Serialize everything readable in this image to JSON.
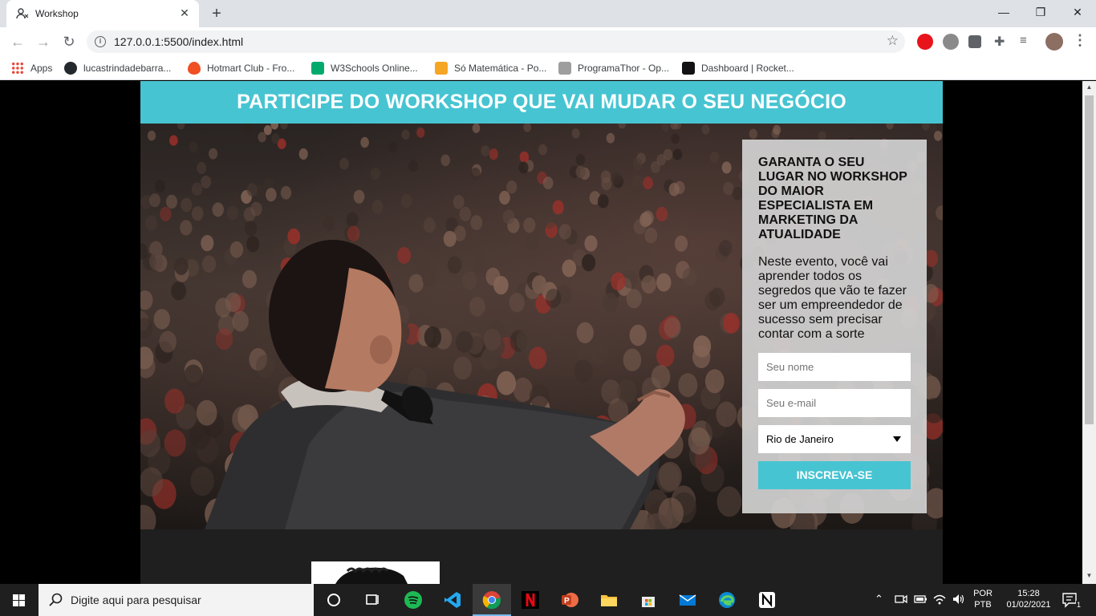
{
  "browser": {
    "tab_title": "Workshop",
    "new_tab": "+",
    "url": "127.0.0.1:5500/index.html",
    "window_controls": {
      "minimize": "—",
      "restore": "❐",
      "close": "✕"
    }
  },
  "bookmarks": [
    {
      "label": "Apps",
      "icon": "apps-grid-icon",
      "color": "#4285f4"
    },
    {
      "label": "lucastrindadebarra...",
      "icon": "github-icon",
      "color": "#24292e"
    },
    {
      "label": "Hotmart Club - Fro...",
      "icon": "hotmart-icon",
      "color": "#f04e23"
    },
    {
      "label": "W3Schools Online...",
      "icon": "w3schools-icon",
      "color": "#04aa6d"
    },
    {
      "label": "Só Matemática - Po...",
      "icon": "somatematica-icon",
      "color": "#f5a623"
    },
    {
      "label": "ProgramaThor - Op...",
      "icon": "programathor-icon",
      "color": "#9e9e9e"
    },
    {
      "label": "Dashboard | Rocket...",
      "icon": "rocketseat-icon",
      "color": "#121214"
    }
  ],
  "page": {
    "header": "PARTICIPE DO WORKSHOP QUE VAI MUDAR O SEU NEGÓCIO",
    "form": {
      "title": "GARANTA O SEU LUGAR NO WORKSHOP DO MAIOR ESPECIALISTA EM MARKETING DA ATUALIDADE",
      "description": "Neste evento, você vai aprender todos os segredos que vão te fazer ser um empreendedor de sucesso sem precisar contar com a sorte",
      "name_placeholder": "Seu nome",
      "email_placeholder": "Seu e-mail",
      "city_selected": "Rio de Janeiro",
      "submit_label": "INSCREVA-SE"
    },
    "colors": {
      "accent": "#47c4d2",
      "panel": "#d2d2d2"
    }
  },
  "taskbar": {
    "search_placeholder": "Digite aqui para pesquisar",
    "lang_line1": "POR",
    "lang_line2": "PTB",
    "time": "15:28",
    "date": "01/02/2021",
    "notifications": "1"
  }
}
